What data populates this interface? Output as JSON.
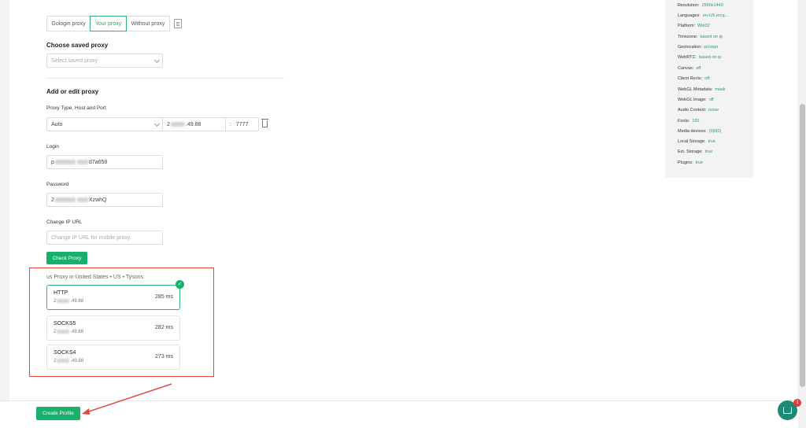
{
  "proxy_tabs": [
    "Gologin proxy",
    "Your proxy",
    "Without proxy"
  ],
  "saved": {
    "heading": "Choose saved proxy",
    "placeholder": "Select saved proxy"
  },
  "edit": {
    "heading": "Add or edit proxy",
    "type_label": "Proxy Type, Host and Port",
    "type_value": "Auto",
    "host_prefix": "2",
    "host_suffix": ".49.88",
    "port_sep": ":",
    "port": "7777",
    "login_label": "Login",
    "login_prefix": "p",
    "login_suffix": "d7a658",
    "password_label": "Password",
    "password_prefix": "2",
    "password_suffix": "XzwhQ",
    "change_ip_label": "Change IP URL",
    "change_ip_placeholder": "Change IP URL for mobile proxy",
    "check_button": "Check Proxy"
  },
  "result": {
    "location": "us Proxy in United States • US • Tysons",
    "cards": [
      {
        "type": "HTTP",
        "host_prefix": "2",
        "host_suffix": ".49.88",
        "ms": "285 ms",
        "selected": true
      },
      {
        "type": "SOCKS5",
        "host_prefix": "2",
        "host_suffix": ".49.88",
        "ms": "282 ms",
        "selected": false
      },
      {
        "type": "SOCKS4",
        "host_prefix": "2",
        "host_suffix": ".49.88",
        "ms": "273 ms",
        "selected": false
      }
    ]
  },
  "fingerprint": [
    {
      "key": "Resolution:",
      "value": "2560x1440"
    },
    {
      "key": "Languages:",
      "value": "en-US,en;q..."
    },
    {
      "key": "Platform:",
      "value": "Win32"
    },
    {
      "key": "Timezone:",
      "value": "based on ip"
    },
    {
      "key": "Geolocation:",
      "value": "prompt"
    },
    {
      "key": "WebRTC:",
      "value": "based on ip"
    },
    {
      "key": "Canvas:",
      "value": "off"
    },
    {
      "key": "Client Rects:",
      "value": "off"
    },
    {
      "key": "WebGL Metadata:",
      "value": "mask"
    },
    {
      "key": "WebGL Image:",
      "value": "off"
    },
    {
      "key": "Audio Context:",
      "value": "noise"
    },
    {
      "key": "Fonts:",
      "value": "165"
    },
    {
      "key": "Media devices:",
      "value": "(0|0|0)"
    },
    {
      "key": "Local Storage:",
      "value": "true"
    },
    {
      "key": "Ext. Storage:",
      "value": "true"
    },
    {
      "key": "Plugins:",
      "value": "true"
    }
  ],
  "footer": {
    "create_button": "Create Profile",
    "chat_badge": "1"
  },
  "colors": {
    "accent": "#18b06a",
    "highlight": "#e8463f",
    "value_text": "#2e9a5e"
  }
}
